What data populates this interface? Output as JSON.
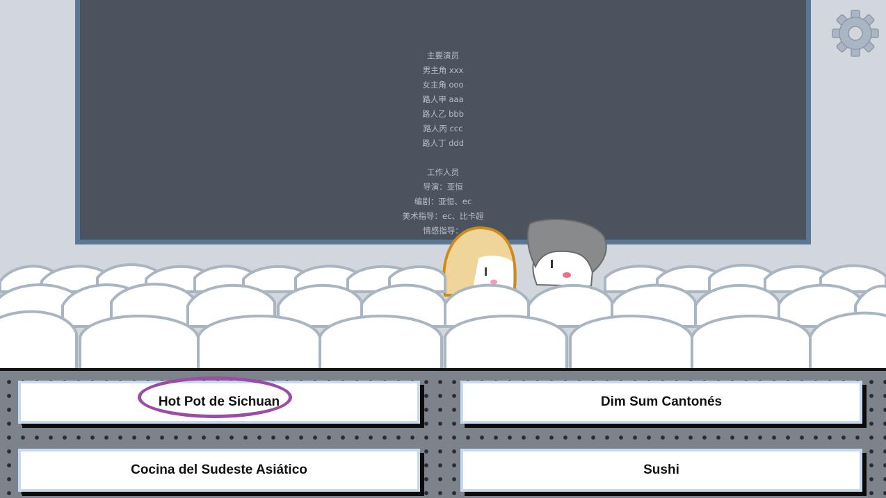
{
  "credits": {
    "cast_heading": "主要演员",
    "cast": [
      "男主角 xxx",
      "女主角 ooo",
      "路人甲 aaa",
      "路人乙 bbb",
      "路人丙 ccc",
      "路人丁 ddd"
    ],
    "staff_heading": "工作人员",
    "staff": [
      "导演：亚恒",
      "编剧：亚恒、ec",
      "美术指导：ec、比卡超",
      "情感指导："
    ]
  },
  "settings": {
    "icon": "gear-icon"
  },
  "choices": {
    "option_1": "Hot Pot de Sichuan",
    "option_2": "Dim Sum Cantonés",
    "option_3": "Cocina del Sudeste Asiático",
    "option_4": "Sushi"
  },
  "colors": {
    "screen": "#4b545e",
    "screen_border": "#5b7796",
    "wall": "#d2d7de",
    "seat_outline": "#a9b4c0",
    "highlight": "#9b4ca3",
    "panel": "#7d838b"
  }
}
